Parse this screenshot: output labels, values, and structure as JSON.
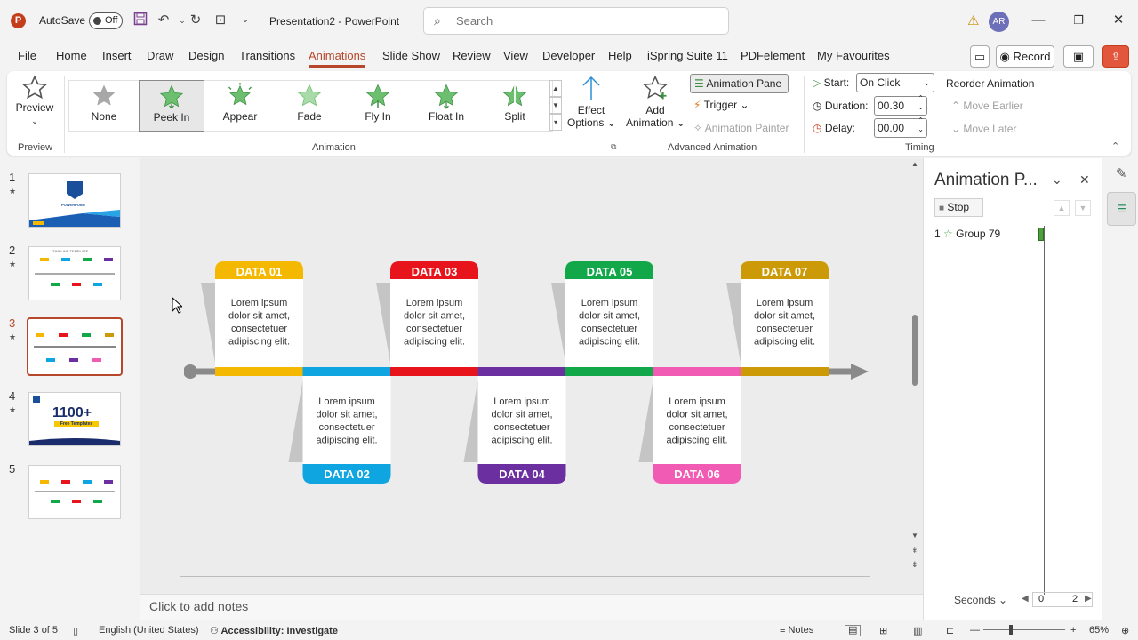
{
  "titlebar": {
    "app_icon_letter": "P",
    "autosave_label": "AutoSave",
    "autosave_state": "Off",
    "doc_title": "Presentation2 - PowerPoint",
    "search_placeholder": "Search",
    "avatar_initials": "AR"
  },
  "menu": {
    "tabs": [
      "File",
      "Home",
      "Insert",
      "Draw",
      "Design",
      "Transitions",
      "Animations",
      "Slide Show",
      "Review",
      "View",
      "Developer",
      "Help",
      "iSpring Suite 11",
      "PDFelement",
      "My Favourites"
    ],
    "active_tab": "Animations",
    "record_label": "Record"
  },
  "ribbon": {
    "preview_label": "Preview",
    "preview_group": "Preview",
    "animations": [
      "None",
      "Peek In",
      "Appear",
      "Fade",
      "Fly In",
      "Float In",
      "Split"
    ],
    "selected_animation": "Peek In",
    "effect_options_line1": "Effect",
    "effect_options_line2": "Options",
    "animation_group": "Animation",
    "add_animation_line1": "Add",
    "add_animation_line2": "Animation",
    "animation_pane_label": "Animation Pane",
    "trigger_label": "Trigger",
    "animation_painter_label": "Animation Painter",
    "advanced_group": "Advanced Animation",
    "start_label": "Start:",
    "start_value": "On Click",
    "duration_label": "Duration:",
    "duration_value": "00.30",
    "delay_label": "Delay:",
    "delay_value": "00.00",
    "timing_group": "Timing",
    "reorder_label": "Reorder Animation",
    "move_earlier_label": "Move Earlier",
    "move_later_label": "Move Later"
  },
  "thumbnails": [
    {
      "num": "1",
      "star": "★",
      "title": "POWERPOINT"
    },
    {
      "num": "2",
      "star": "★",
      "title": "TIMELINE TEMPLATE"
    },
    {
      "num": "3",
      "star": "★",
      "title": ""
    },
    {
      "num": "4",
      "star": "★",
      "title": "1100+",
      "subtitle": "Free Templates"
    },
    {
      "num": "5",
      "star": "",
      "title": ""
    }
  ],
  "slide": {
    "body_text_line1": "Lorem ipsum",
    "body_text_line2": "dolor sit amet,",
    "body_text_line3": "consectetuer",
    "body_text_line4": "adipiscing elit.",
    "cards": [
      {
        "label": "DATA 01",
        "color": "#f5b800",
        "pos": "top"
      },
      {
        "label": "DATA 02",
        "color": "#0ea5e0",
        "pos": "bottom"
      },
      {
        "label": "DATA 03",
        "color": "#e8141b",
        "pos": "top"
      },
      {
        "label": "DATA 04",
        "color": "#6b2fa0",
        "pos": "bottom"
      },
      {
        "label": "DATA 05",
        "color": "#12a84a",
        "pos": "top"
      },
      {
        "label": "DATA 06",
        "color": "#f25bb4",
        "pos": "bottom"
      },
      {
        "label": "DATA 07",
        "color": "#cc9a06",
        "pos": "top"
      }
    ]
  },
  "notes_placeholder": "Click to add notes",
  "animation_pane": {
    "title": "Animation P...",
    "stop_label": "Stop",
    "item_number": "1",
    "item_name": "Group 79",
    "seconds_label": "Seconds",
    "timeline_start": "0",
    "timeline_end": "2"
  },
  "status": {
    "slide_info": "Slide 3 of 5",
    "language": "English (United States)",
    "accessibility": "Accessibility: Investigate",
    "notes_label": "Notes",
    "zoom": "65%"
  },
  "colors": {
    "accent": "#b7472a",
    "star_green": "#6bbf6f"
  }
}
